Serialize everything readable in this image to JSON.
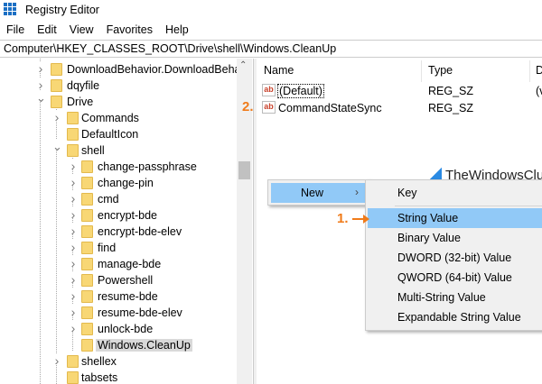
{
  "window": {
    "title": "Registry Editor"
  },
  "menu": [
    "File",
    "Edit",
    "View",
    "Favorites",
    "Help"
  ],
  "address": "Computer\\HKEY_CLASSES_ROOT\\Drive\\shell\\Windows.CleanUp",
  "tree": [
    {
      "label": "DownloadBehavior.DownloadBehav",
      "level": 1,
      "chevron": "right"
    },
    {
      "label": "dqyfile",
      "level": 1,
      "chevron": "right"
    },
    {
      "label": "Drive",
      "level": 1,
      "chevron": "down"
    },
    {
      "label": "Commands",
      "level": 2,
      "chevron": "right"
    },
    {
      "label": "DefaultIcon",
      "level": 2,
      "chevron": "none"
    },
    {
      "label": "shell",
      "level": 2,
      "chevron": "down"
    },
    {
      "label": "change-passphrase",
      "level": 3,
      "chevron": "right"
    },
    {
      "label": "change-pin",
      "level": 3,
      "chevron": "right"
    },
    {
      "label": "cmd",
      "level": 3,
      "chevron": "right"
    },
    {
      "label": "encrypt-bde",
      "level": 3,
      "chevron": "right"
    },
    {
      "label": "encrypt-bde-elev",
      "level": 3,
      "chevron": "right"
    },
    {
      "label": "find",
      "level": 3,
      "chevron": "right"
    },
    {
      "label": "manage-bde",
      "level": 3,
      "chevron": "right"
    },
    {
      "label": "Powershell",
      "level": 3,
      "chevron": "right"
    },
    {
      "label": "resume-bde",
      "level": 3,
      "chevron": "right"
    },
    {
      "label": "resume-bde-elev",
      "level": 3,
      "chevron": "right"
    },
    {
      "label": "unlock-bde",
      "level": 3,
      "chevron": "right"
    },
    {
      "label": "Windows.CleanUp",
      "level": 3,
      "chevron": "none",
      "selected": true
    },
    {
      "label": "shellex",
      "level": 2,
      "chevron": "right"
    },
    {
      "label": "tabsets",
      "level": 2,
      "chevron": "none"
    }
  ],
  "columns": {
    "name": "Name",
    "type": "Type",
    "data": "D"
  },
  "values": [
    {
      "name": "(Default)",
      "type": "REG_SZ",
      "data": "(v"
    },
    {
      "name": "CommandStateSync",
      "type": "REG_SZ",
      "data": ""
    }
  ],
  "context_menu": {
    "new_label": "New",
    "arrow": "›"
  },
  "submenu": [
    "Key",
    "String Value",
    "Binary Value",
    "DWORD (32-bit) Value",
    "QWORD (64-bit) Value",
    "Multi-String Value",
    "Expandable String Value"
  ],
  "watermark": "TheWindowsClub",
  "annotations": {
    "step1": "1.",
    "step2": "2."
  },
  "icons": {
    "scroll_up": "⌃",
    "value_icon": "ab"
  },
  "colors": {
    "highlight": "#91c9f7",
    "annotation": "#f07b1a",
    "folder": "#f8d775"
  }
}
